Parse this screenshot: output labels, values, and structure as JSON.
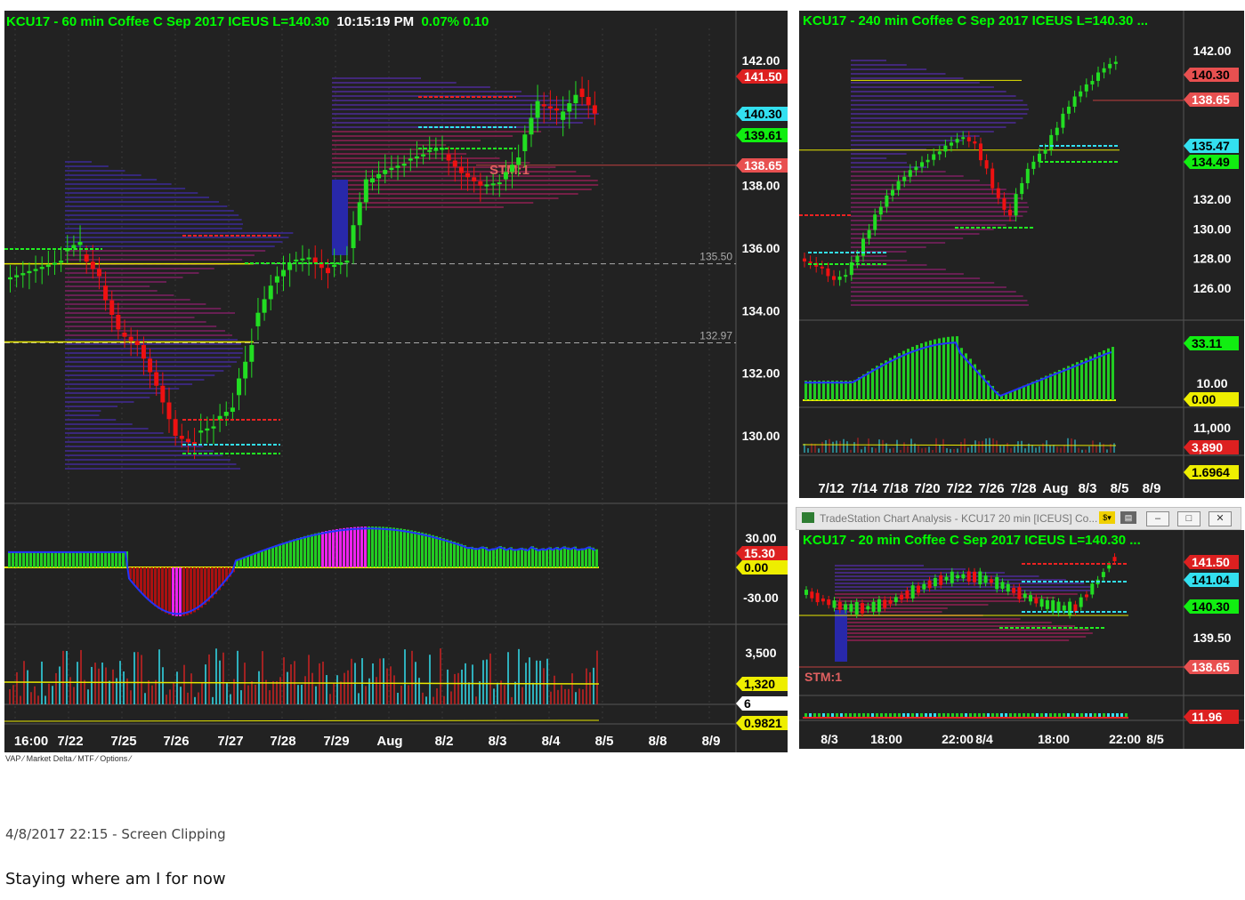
{
  "main": {
    "header": {
      "symbol": "KCU17 - 60 min  Coffee C Sep 2017  ICEUS  L=140.30",
      "time": "10:15:19 PM",
      "chg": "0.07%  0.10"
    },
    "price_axis": [
      "142.00",
      "138.00",
      "136.00",
      "134.00",
      "132.00",
      "130.00"
    ],
    "flags": [
      {
        "text": "141.50",
        "bg": "#dd2020",
        "fg": "#ffffff"
      },
      {
        "text": "140.30",
        "bg": "#33e0f0",
        "fg": "#000000"
      },
      {
        "text": "139.61",
        "bg": "#11ee11",
        "fg": "#000000"
      },
      {
        "text": "138.65",
        "bg": "#e85050",
        "fg": "#ffffff"
      }
    ],
    "levels": [
      "135.50",
      "132.97"
    ],
    "stm": "STM:1",
    "ind_axis": [
      "30.00",
      "-30.00"
    ],
    "ind_flags": [
      {
        "text": "15.30",
        "bg": "#dd2020",
        "fg": "#ffffff"
      },
      {
        "text": "0.00",
        "bg": "#eeee00",
        "fg": "#000000"
      }
    ],
    "vol_axis": [
      "3,500"
    ],
    "vol_flags": [
      {
        "text": "1,320",
        "bg": "#eeee00",
        "fg": "#000000"
      },
      {
        "text": "6",
        "bg": "#ffffff",
        "fg": "#000000"
      }
    ],
    "low_flag": {
      "text": "0.9821",
      "bg": "#eeee00",
      "fg": "#000000"
    },
    "dates": [
      "16:00",
      "7/22",
      "7/25",
      "7/26",
      "7/27",
      "7/28",
      "7/29",
      "Aug",
      "8/2",
      "8/3",
      "8/4",
      "8/5",
      "8/8",
      "8/9"
    ],
    "bottom_tabs": "VAP  ⁄  Market Delta ⁄  MTF ⁄  Options ⁄"
  },
  "topright": {
    "header": "KCU17 - 240 min  Coffee C Sep 2017  ICEUS  L=140.30  ...",
    "price_axis": [
      "142.00",
      "132.00",
      "130.00",
      "128.00",
      "126.00"
    ],
    "flags": [
      {
        "text": "140.30",
        "bg": "#e85050",
        "fg": "#000000"
      },
      {
        "text": "138.65",
        "bg": "#e85050",
        "fg": "#ffffff"
      },
      {
        "text": "135.47",
        "bg": "#33e0f0",
        "fg": "#000000"
      },
      {
        "text": "134.49",
        "bg": "#11ee11",
        "fg": "#000000"
      }
    ],
    "ind_axis": [
      "10.00"
    ],
    "ind_flags": [
      {
        "text": "33.11",
        "bg": "#11ee11",
        "fg": "#000000"
      },
      {
        "text": "0.00",
        "bg": "#eeee00",
        "fg": "#000000"
      }
    ],
    "vol_axis": [
      "11,000"
    ],
    "vol_flags": [
      {
        "text": "3,890",
        "bg": "#dd2020",
        "fg": "#ffffff"
      }
    ],
    "low_flag": {
      "text": "1.6964",
      "bg": "#eeee00",
      "fg": "#000000"
    },
    "dates": [
      "7/12",
      "7/14",
      "7/18",
      "7/20",
      "7/22",
      "7/26",
      "7/28",
      "Aug",
      "8/3",
      "8/5",
      "8/9"
    ]
  },
  "bottomright": {
    "window_title": "TradeStation Chart Analysis - KCU17 20 min [ICEUS] Co...",
    "header": "KCU17 - 20 min  Coffee C Sep 2017  ICEUS  L=140.30  ...",
    "price_axis": [
      "139.50"
    ],
    "flags": [
      {
        "text": "141.50",
        "bg": "#dd2020",
        "fg": "#ffffff"
      },
      {
        "text": "141.04",
        "bg": "#33e0f0",
        "fg": "#000000"
      },
      {
        "text": "140.30",
        "bg": "#11ee11",
        "fg": "#000000"
      },
      {
        "text": "138.65",
        "bg": "#e85050",
        "fg": "#ffffff"
      }
    ],
    "stm": "STM:1",
    "ind_flag": {
      "text": "11.96",
      "bg": "#dd2020",
      "fg": "#ffffff"
    },
    "dates": [
      "8/3",
      "18:00",
      "22:00",
      "8/4",
      "18:00",
      "22:00",
      "8/5"
    ]
  },
  "caption": {
    "timestamp": "4/8/2017 22:15 - Screen Clipping",
    "note": "Staying where am I for now"
  },
  "chart_data": {
    "type": "bar",
    "title": "KCU17 - 60 min  Coffee C Sep 2017  ICEUS  L=140.30",
    "ylim": [
      129,
      142.5
    ],
    "series": [
      {
        "name": "close",
        "values": [
          135.2,
          135.4,
          135.6,
          136.2,
          135.1,
          133.4,
          132.9,
          131.6,
          130.0,
          129.7,
          130.3,
          130.9,
          132.9,
          134.8,
          135.5,
          135.7,
          135.2,
          135.6,
          138.2,
          138.5,
          138.7,
          139.0,
          139.2,
          138.4,
          138.0,
          138.1,
          138.9,
          140.7,
          140.4,
          140.9,
          140.3
        ]
      },
      {
        "name": "open",
        "values": [
          135.0,
          135.2,
          135.4,
          135.9,
          135.8,
          134.8,
          133.3,
          132.9,
          131.6,
          130.0,
          130.1,
          130.5,
          131.3,
          133.5,
          134.9,
          135.6,
          135.7,
          135.4,
          136.0,
          138.1,
          138.5,
          138.8,
          139.1,
          139.0,
          138.4,
          138.0,
          138.2,
          139.1,
          140.6,
          140.1,
          141.1
        ]
      }
    ]
  }
}
